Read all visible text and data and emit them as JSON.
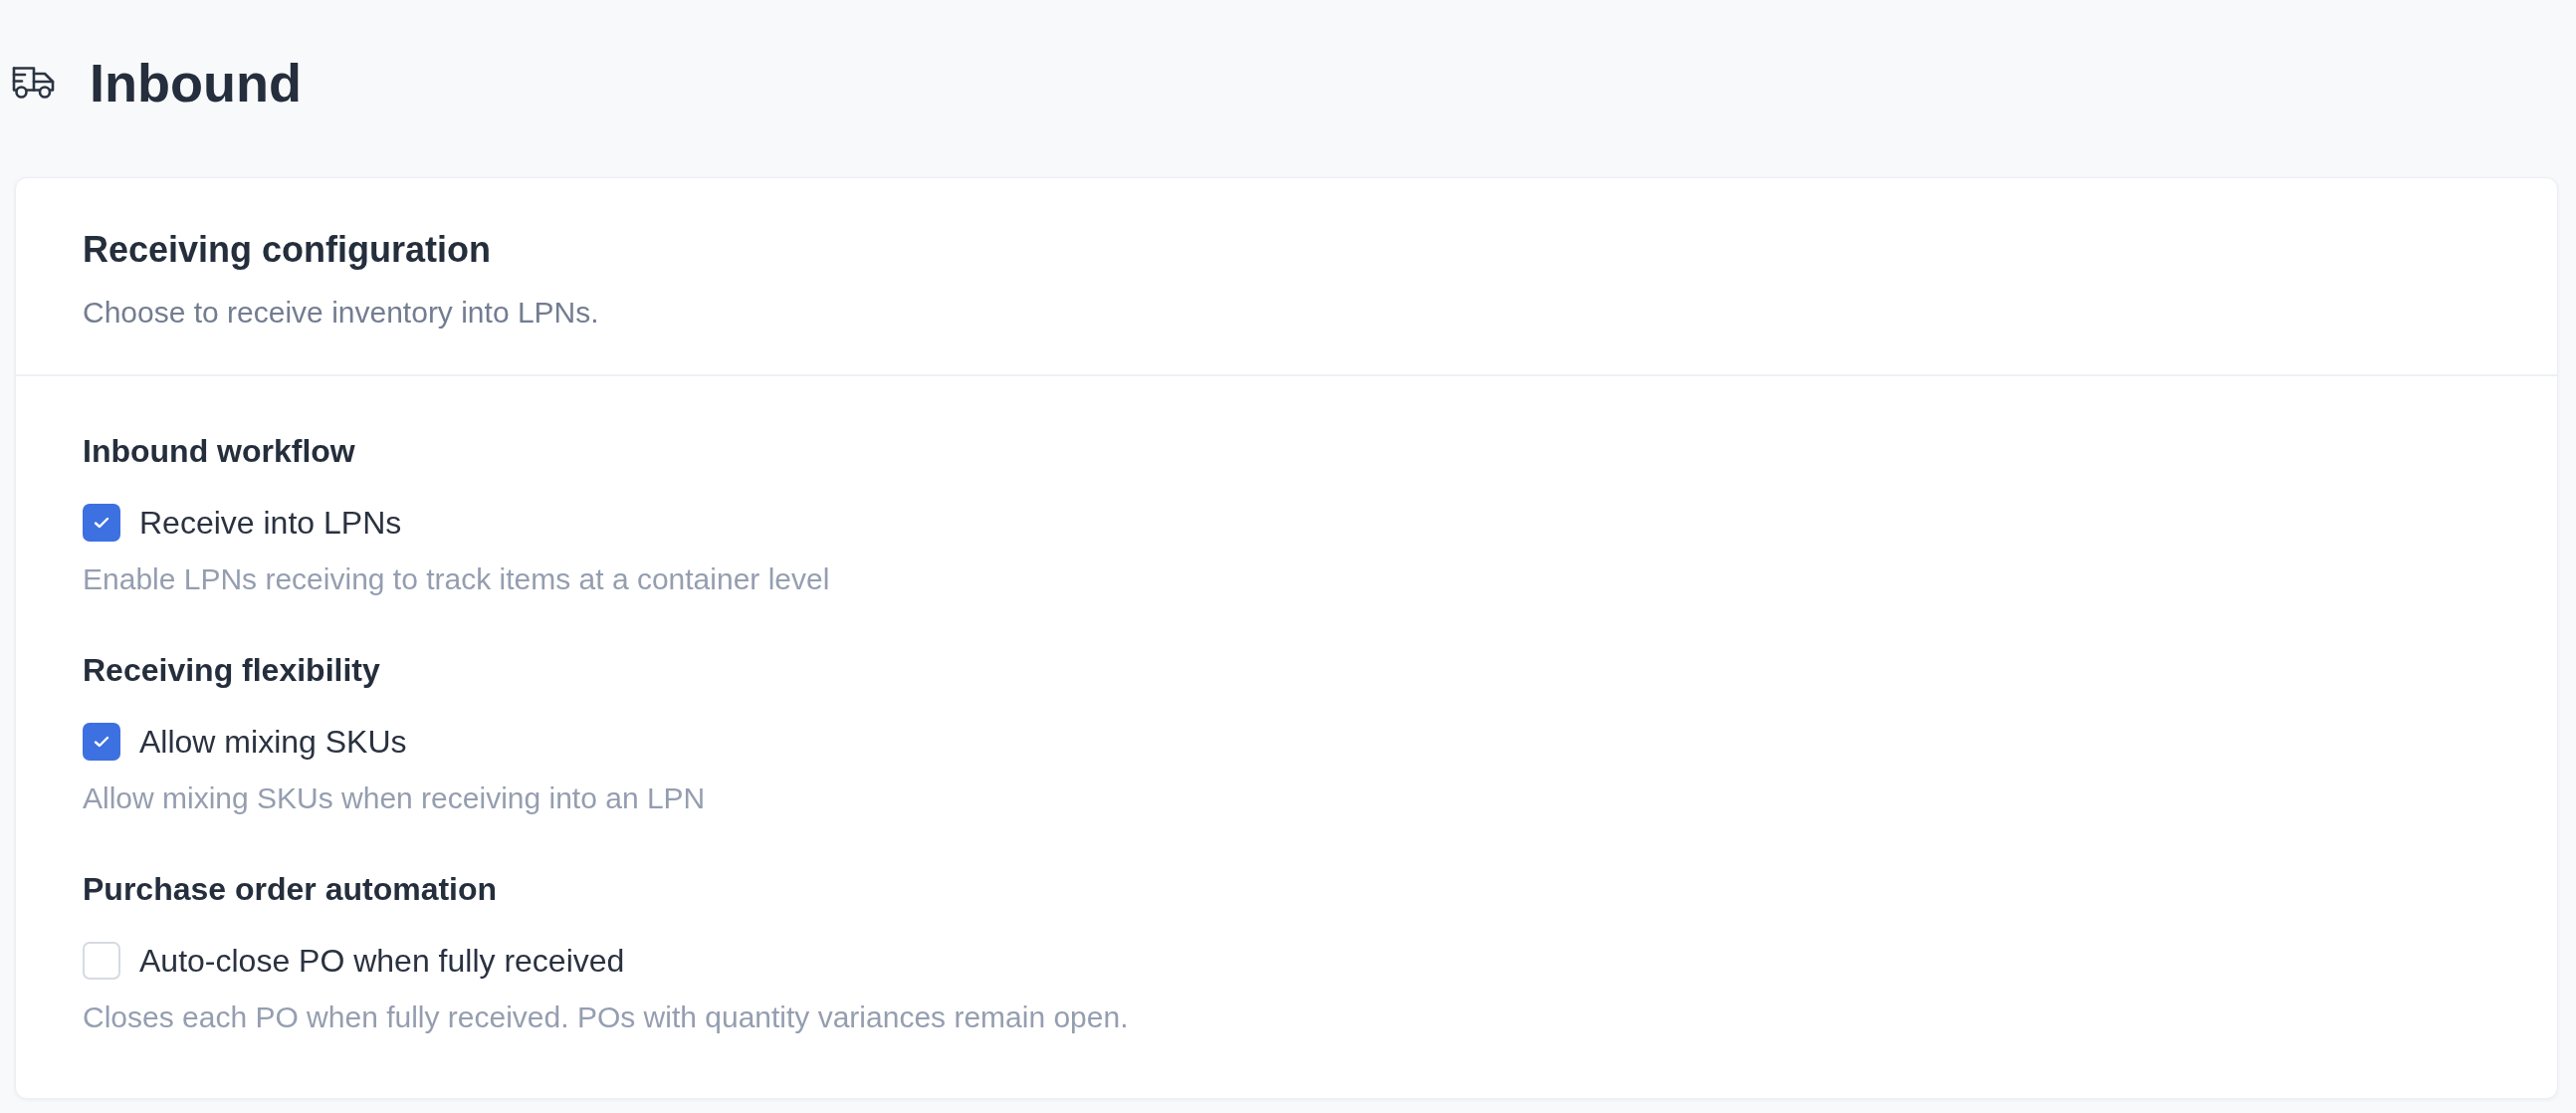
{
  "page": {
    "title": "Inbound"
  },
  "card": {
    "title": "Receiving configuration",
    "subtitle": "Choose to receive inventory into LPNs."
  },
  "sections": [
    {
      "heading": "Inbound workflow",
      "option": {
        "label": "Receive into LPNs",
        "checked": true,
        "description": "Enable LPNs receiving to track items at a container level"
      }
    },
    {
      "heading": "Receiving flexibility",
      "option": {
        "label": "Allow mixing SKUs",
        "checked": true,
        "description": "Allow mixing SKUs when receiving into an LPN"
      }
    },
    {
      "heading": "Purchase order automation",
      "option": {
        "label": "Auto-close PO when fully received",
        "checked": false,
        "description": "Closes each PO when fully received. POs with quantity variances remain open."
      }
    }
  ]
}
